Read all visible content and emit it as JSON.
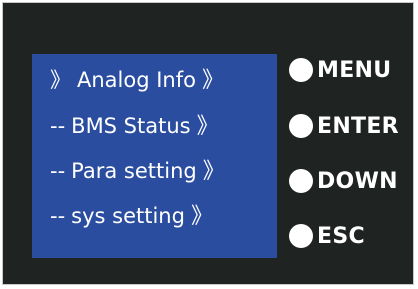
{
  "screen": {
    "items": [
      {
        "prefix": "》",
        "label": "Analog Info",
        "chev": "》"
      },
      {
        "prefix": "--",
        "label": "BMS Status",
        "chev": "》"
      },
      {
        "prefix": "--",
        "label": "Para setting",
        "chev": "》"
      },
      {
        "prefix": "--",
        "label": "sys setting",
        "chev": "》"
      }
    ]
  },
  "buttons": [
    {
      "label": "MENU"
    },
    {
      "label": "ENTER"
    },
    {
      "label": "DOWN"
    },
    {
      "label": "ESC"
    }
  ],
  "colors": {
    "panel": "#1f2322",
    "screen": "#2a4da0",
    "text": "#ffffff"
  }
}
